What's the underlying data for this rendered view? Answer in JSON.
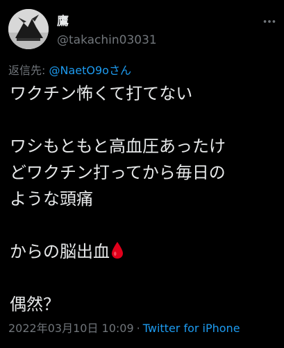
{
  "user": {
    "display_name": "鷹",
    "handle": "@takachin03031",
    "avatar_icon": "user-avatar-bird-icon"
  },
  "more_icon": "more-options-icon",
  "reply": {
    "prefix": "返信先:",
    "mention": "@NaetO9oさん"
  },
  "tweet": {
    "lines": [
      "ワクチン怖くて打てない",
      "",
      "ワシもともと高血圧あったけ",
      "どワクチン打ってから毎日の",
      "ような頭痛",
      "",
      "からの脳出血",
      "",
      "偶然？"
    ],
    "emoji_icon": "blood-drop-icon"
  },
  "meta": {
    "timestamp": "2022年03月10日 10:09",
    "separator": "·",
    "client": "Twitter for iPhone"
  },
  "colors": {
    "background": "#000000",
    "text": "#e7e9ea",
    "secondary": "#71767b",
    "link": "#1d9bf0",
    "blood": "#e0001b"
  }
}
